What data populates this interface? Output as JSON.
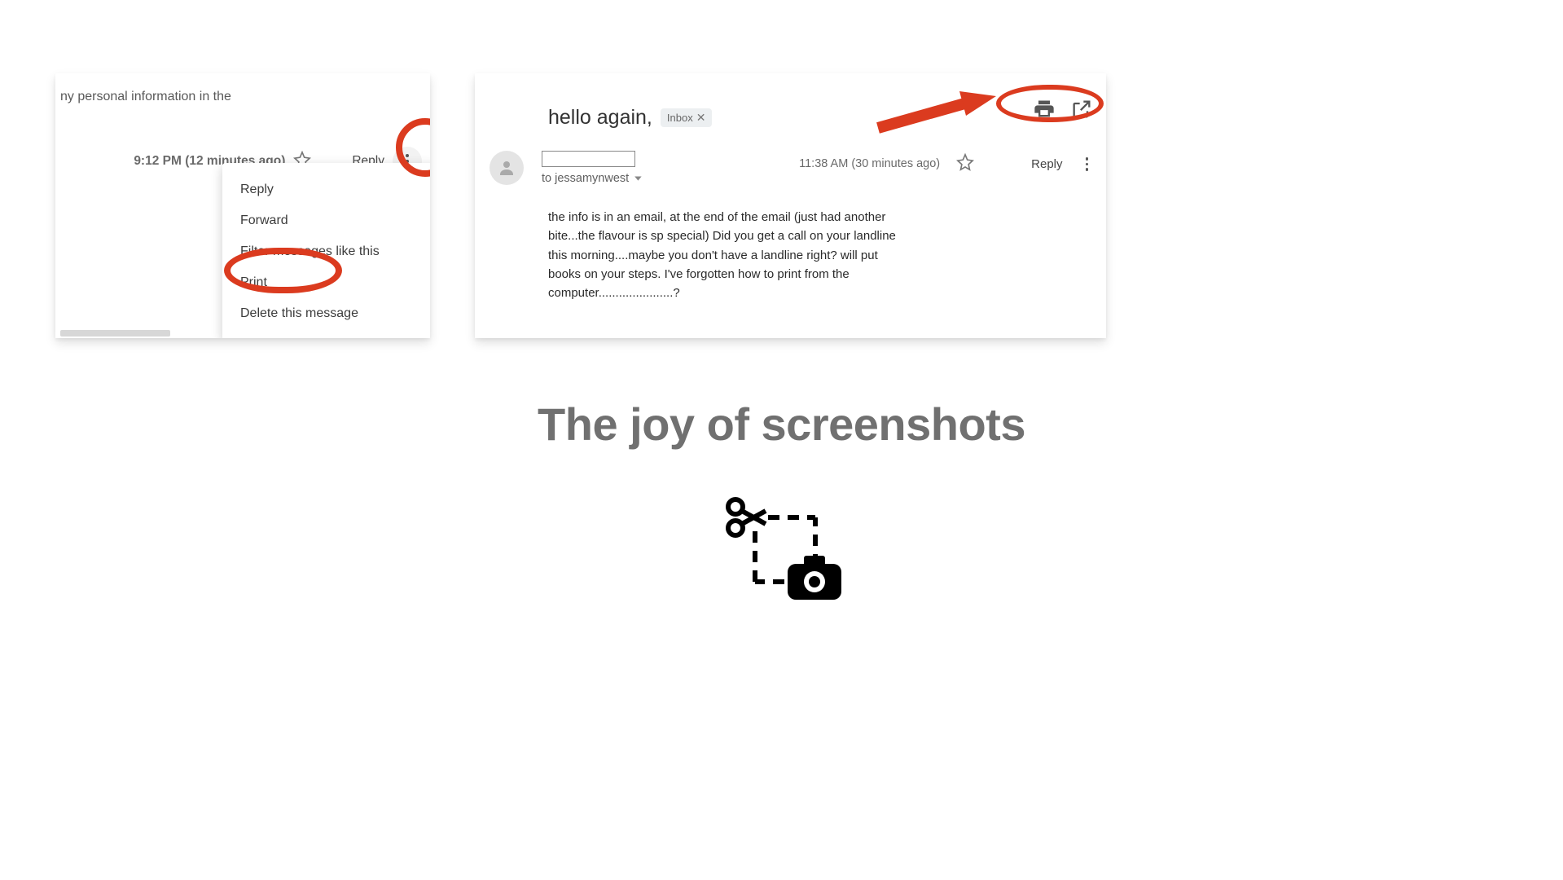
{
  "left": {
    "top_text": "ny personal information in the",
    "timestamp": "9:12 PM (12 minutes ago)",
    "reply": "Reply",
    "menu": {
      "reply": "Reply",
      "forward": "Forward",
      "filter": "Filter messages like this",
      "print": "Print",
      "delete": "Delete this message"
    }
  },
  "right": {
    "subject": "hello again,",
    "inbox_label": "Inbox",
    "recipient": "to jessamynwest",
    "timestamp": "11:38 AM (30 minutes ago)",
    "reply": "Reply",
    "body": "the info is in an email, at the end of the email (just had another bite...the flavour is sp special)   Did you get a call on your landline this morning....maybe you don't have a landline right?  will put books on your steps. I've forgotten how to print from the computer......................?"
  },
  "title": "The joy of screenshots"
}
